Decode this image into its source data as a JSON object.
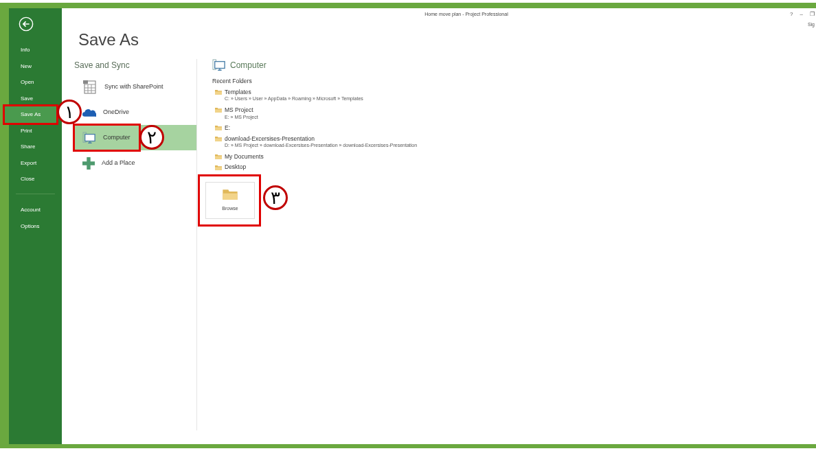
{
  "window": {
    "title": "Home move plan - Project Professional",
    "controls": [
      "?",
      "–",
      "❐"
    ],
    "account": "Sig"
  },
  "backstage": {
    "items": [
      {
        "label": "Info",
        "selected": false,
        "highlighted": false
      },
      {
        "label": "New",
        "selected": false,
        "highlighted": false
      },
      {
        "label": "Open",
        "selected": false,
        "highlighted": false
      },
      {
        "label": "Save",
        "selected": false,
        "highlighted": false
      },
      {
        "label": "Save As",
        "selected": true,
        "highlighted": true,
        "annotation": "١"
      },
      {
        "label": "Print",
        "selected": false,
        "highlighted": false
      },
      {
        "label": "Share",
        "selected": false,
        "highlighted": false
      },
      {
        "label": "Export",
        "selected": false,
        "highlighted": false
      },
      {
        "label": "Close",
        "selected": false,
        "highlighted": false
      }
    ],
    "footer_items": [
      {
        "label": "Account",
        "selected": false
      },
      {
        "label": "Options",
        "selected": false
      }
    ]
  },
  "page_title": "Save As",
  "places": {
    "heading": "Save and Sync",
    "items": [
      {
        "kind": "sharepoint",
        "label": "Sync with SharePoint",
        "selected": false,
        "highlighted": false
      },
      {
        "kind": "onedrive",
        "label": "OneDrive",
        "selected": false,
        "highlighted": false
      },
      {
        "kind": "computer",
        "label": "Computer",
        "selected": true,
        "highlighted": true,
        "annotation": "٢"
      },
      {
        "kind": "add",
        "label": "Add a Place",
        "selected": false,
        "highlighted": false
      }
    ]
  },
  "detail": {
    "heading": "Computer",
    "recent_heading": "Recent Folders",
    "folders": [
      {
        "name": "Templates",
        "path": "C: » Users » User » AppData » Roaming » Microsoft » Templates"
      },
      {
        "name": "MS Project",
        "path": "E: » MS Project"
      },
      {
        "name": "E:"
      },
      {
        "name": "download-Excersises-Presentation",
        "path": "D: » MS Project » download-Excersises-Presentation » download-Excersises-Presentation"
      },
      {
        "name": "My Documents"
      },
      {
        "name": "Desktop"
      }
    ],
    "browse": {
      "label": "Browse",
      "highlighted": true,
      "annotation": "٣"
    }
  }
}
